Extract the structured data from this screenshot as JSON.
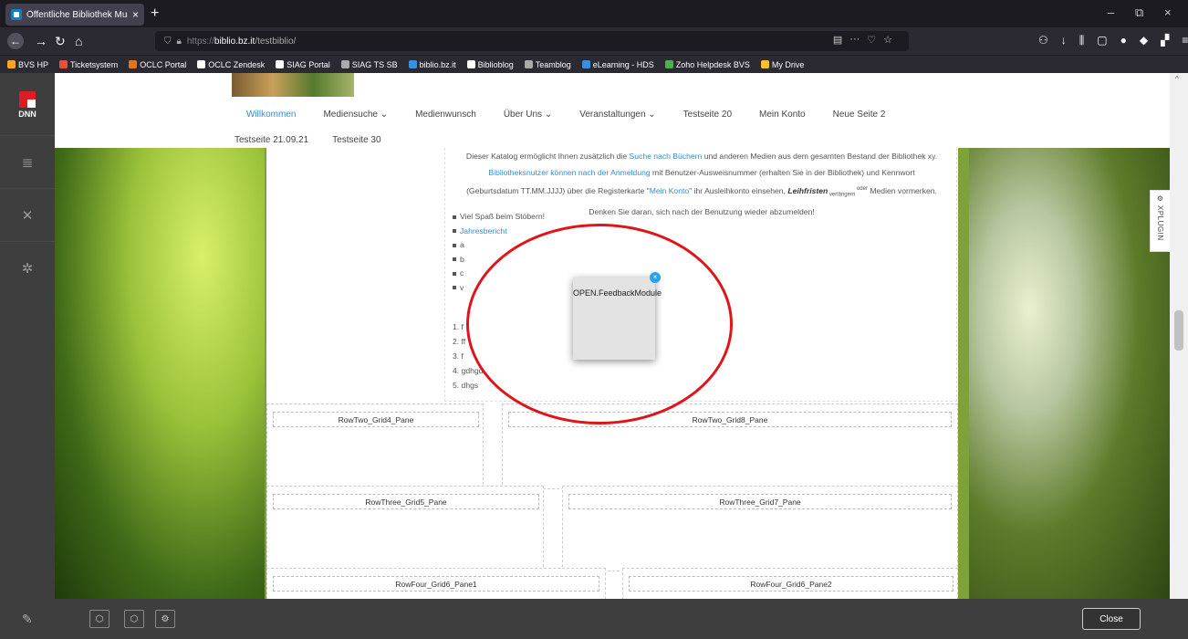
{
  "browser": {
    "tab_title": "Öffentliche Bibliothek Musterh",
    "tab_close": "×",
    "new_tab": "+",
    "url_protocol": "https://",
    "url_host": "biblio.bz.it",
    "url_path": "/testbiblio/",
    "window_controls": [
      "–",
      "⧉",
      "×"
    ],
    "bookmarks": [
      {
        "label": "BVS HP",
        "color": "#f5a623"
      },
      {
        "label": "Ticketsystem",
        "color": "#e94e3c"
      },
      {
        "label": "OCLC Portal",
        "color": "#e0751a"
      },
      {
        "label": "OCLC Zendesk",
        "color": "#ffffff"
      },
      {
        "label": "SIAG Portal",
        "color": "#ffffff"
      },
      {
        "label": "SIAG TS SB",
        "color": "#aaaaaa"
      },
      {
        "label": "biblio.bz.it",
        "color": "#3b8dde"
      },
      {
        "label": "Biblioblog",
        "color": "#ffffff"
      },
      {
        "label": "Teamblog",
        "color": "#aaaaaa"
      },
      {
        "label": "eLearning - HDS",
        "color": "#3b8dde"
      },
      {
        "label": "Zoho Helpdesk BVS",
        "color": "#4caf50"
      },
      {
        "label": "My Drive",
        "color": "#fbc02d"
      }
    ]
  },
  "dnn": {
    "logo_text": "DNN",
    "close_label": "Close"
  },
  "site": {
    "menu": [
      {
        "label": "Willkommen",
        "active": true
      },
      {
        "label": "Mediensuche ⌄",
        "active": false
      },
      {
        "label": "Medienwunsch",
        "active": false
      },
      {
        "label": "Über Uns ⌄",
        "active": false
      },
      {
        "label": "Veranstaltungen ⌄",
        "active": false
      },
      {
        "label": "Testseite 20",
        "active": false
      },
      {
        "label": "Mein Konto",
        "active": false
      },
      {
        "label": "Neue Seite 2",
        "active": false
      }
    ],
    "menu_row2": [
      "Testseite 21.09.21",
      "Testseite 30"
    ],
    "intro": {
      "line1_a": "Dieser Katalog ermöglicht Ihnen zusätzlich die ",
      "line1_link": "Suche nach Büchern",
      "line1_b": " und anderen Medien aus dem gesamten Bestand der Bibliothek xy.",
      "line2_link": "Bibliotheksnutzer können nach der Anmeldung",
      "line2_b": " mit Benutzer-Ausweisnummer (erhalten Sie in der Bibliothek) und Kennwort",
      "line3_a": "(Geburtsdatum TT.MM.JJJJ) über die Registerkarte \"",
      "line3_link": "Mein Konto",
      "line3_b": "\" ihr Ausleihkonto einsehen, ",
      "line3_bold": "Leihfristen",
      "line3_small1": " verlängern ",
      "line3_small2": "oder",
      "line3_c": " Medien vormerken.",
      "line4": "Denken Sie daran, sich nach der Benutzung wieder abzumelden!"
    },
    "bullets": [
      {
        "text": "Viel Spaß beim Stöbern!",
        "link": false
      },
      {
        "text": "Jahresbericht",
        "link": true
      },
      {
        "text": "a",
        "link": false
      },
      {
        "text": "b",
        "link": false
      },
      {
        "text": "c",
        "link": false
      },
      {
        "text": "v",
        "link": false
      }
    ],
    "numbered": [
      "1. f",
      "2. ff",
      "3. f",
      "4. gdhgd",
      "5. dhgs"
    ],
    "panes": {
      "row2_left": "RowTwo_Grid4_Pane",
      "row2_right": "RowTwo_Grid8_Pane",
      "row3_left": "RowThree_Grid5_Pane",
      "row3_right": "RowThree_Grid7_Pane",
      "row4_left": "RowFour_Grid6_Pane1",
      "row4_right": "RowFour_Grid6_Pane2"
    }
  },
  "modal": {
    "title": "OPEN.FeedbackModule",
    "close": "×"
  },
  "xplugin": {
    "label": "XPLUGIN"
  }
}
